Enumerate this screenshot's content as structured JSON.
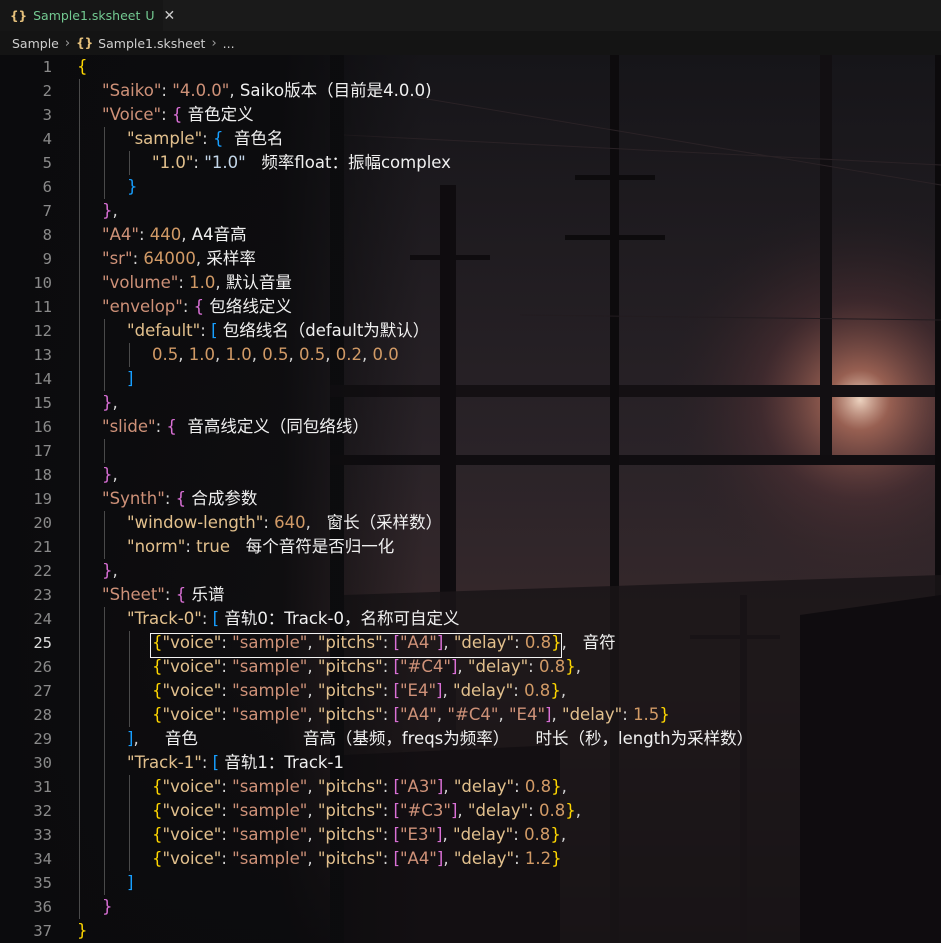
{
  "tab": {
    "icon": "{}",
    "name": "Sample1.sksheet",
    "status": "U",
    "close": "✕"
  },
  "breadcrumb": {
    "folder": "Sample",
    "icon": "{}",
    "file": "Sample1.sksheet",
    "more": "..."
  },
  "colors": {
    "string": "#ce9178",
    "key": "#e2c08d",
    "number": "#d19a66",
    "bracket1": "#ffd700",
    "bracket2": "#da70d6",
    "bracket3": "#179fff"
  },
  "lines": [
    {
      "n": "1",
      "indent": 0,
      "tokens": [
        [
          "b1",
          "{"
        ]
      ]
    },
    {
      "n": "2",
      "indent": 1,
      "tokens": [
        [
          "k1",
          "\"Saiko\""
        ],
        [
          "p",
          ": "
        ],
        [
          "str",
          "\"4.0.0\""
        ],
        [
          "p",
          ", "
        ],
        [
          "cm",
          "Saiko版本（目前是4.0.0)"
        ]
      ]
    },
    {
      "n": "3",
      "indent": 1,
      "tokens": [
        [
          "k1",
          "\"Voice\""
        ],
        [
          "p",
          ": "
        ],
        [
          "b2",
          "{ "
        ],
        [
          "cm",
          "音色定义"
        ]
      ]
    },
    {
      "n": "4",
      "indent": 2,
      "tokens": [
        [
          "k2",
          "\"sample\""
        ],
        [
          "p",
          ": "
        ],
        [
          "b3",
          "{  "
        ],
        [
          "cm",
          "音色名"
        ]
      ]
    },
    {
      "n": "5",
      "indent": 3,
      "tokens": [
        [
          "kw",
          "\"1.0\""
        ],
        [
          "p",
          ": "
        ],
        [
          "strv",
          "\"1.0\""
        ],
        [
          "p",
          "   "
        ],
        [
          "cm",
          "频率float：振幅complex"
        ]
      ]
    },
    {
      "n": "6",
      "indent": 2,
      "tokens": [
        [
          "b3",
          "}"
        ]
      ]
    },
    {
      "n": "7",
      "indent": 1,
      "tokens": [
        [
          "b2",
          "}"
        ],
        [
          "p",
          ","
        ]
      ]
    },
    {
      "n": "8",
      "indent": 1,
      "tokens": [
        [
          "k1",
          "\"A4\""
        ],
        [
          "p",
          ": "
        ],
        [
          "num",
          "440"
        ],
        [
          "p",
          ", "
        ],
        [
          "cm",
          "A4音高"
        ]
      ]
    },
    {
      "n": "9",
      "indent": 1,
      "tokens": [
        [
          "k1",
          "\"sr\""
        ],
        [
          "p",
          ": "
        ],
        [
          "num",
          "64000"
        ],
        [
          "p",
          ", "
        ],
        [
          "cm",
          "采样率"
        ]
      ]
    },
    {
      "n": "10",
      "indent": 1,
      "tokens": [
        [
          "k1",
          "\"volume\""
        ],
        [
          "p",
          ": "
        ],
        [
          "num",
          "1.0"
        ],
        [
          "p",
          ", "
        ],
        [
          "cm",
          "默认音量"
        ]
      ]
    },
    {
      "n": "11",
      "indent": 1,
      "tokens": [
        [
          "k1",
          "\"envelop\""
        ],
        [
          "p",
          ": "
        ],
        [
          "b2",
          "{ "
        ],
        [
          "cm",
          "包络线定义"
        ]
      ]
    },
    {
      "n": "12",
      "indent": 2,
      "tokens": [
        [
          "k2",
          "\"default\""
        ],
        [
          "p",
          ": "
        ],
        [
          "b3",
          "[ "
        ],
        [
          "cm",
          "包络线名（default为默认）"
        ]
      ]
    },
    {
      "n": "13",
      "indent": 3,
      "tokens": [
        [
          "num",
          "0.5"
        ],
        [
          "p",
          ", "
        ],
        [
          "num",
          "1.0"
        ],
        [
          "p",
          ", "
        ],
        [
          "num",
          "1.0"
        ],
        [
          "p",
          ", "
        ],
        [
          "num",
          "0.5"
        ],
        [
          "p",
          ", "
        ],
        [
          "num",
          "0.5"
        ],
        [
          "p",
          ", "
        ],
        [
          "num",
          "0.2"
        ],
        [
          "p",
          ", "
        ],
        [
          "num",
          "0.0"
        ]
      ]
    },
    {
      "n": "14",
      "indent": 2,
      "tokens": [
        [
          "b3",
          "]"
        ]
      ]
    },
    {
      "n": "15",
      "indent": 1,
      "tokens": [
        [
          "b2",
          "}"
        ],
        [
          "p",
          ","
        ]
      ]
    },
    {
      "n": "16",
      "indent": 1,
      "tokens": [
        [
          "k1",
          "\"slide\""
        ],
        [
          "p",
          ": "
        ],
        [
          "b2",
          "{  "
        ],
        [
          "cm",
          "音高线定义（同包络线）"
        ]
      ]
    },
    {
      "n": "17",
      "indent": 2,
      "tokens": []
    },
    {
      "n": "18",
      "indent": 1,
      "tokens": [
        [
          "b2",
          "}"
        ],
        [
          "p",
          ","
        ]
      ]
    },
    {
      "n": "19",
      "indent": 1,
      "tokens": [
        [
          "k1",
          "\"Synth\""
        ],
        [
          "p",
          ": "
        ],
        [
          "b2",
          "{ "
        ],
        [
          "cm",
          "合成参数"
        ]
      ]
    },
    {
      "n": "20",
      "indent": 2,
      "tokens": [
        [
          "k2",
          "\"window-length\""
        ],
        [
          "p",
          ": "
        ],
        [
          "num",
          "640"
        ],
        [
          "p",
          ",   "
        ],
        [
          "cm",
          "窗长（采样数）"
        ]
      ]
    },
    {
      "n": "21",
      "indent": 2,
      "tokens": [
        [
          "k2",
          "\"norm\""
        ],
        [
          "p",
          ": "
        ],
        [
          "kw",
          "true"
        ],
        [
          "p",
          "   "
        ],
        [
          "cm",
          "每个音符是否归一化"
        ]
      ]
    },
    {
      "n": "22",
      "indent": 1,
      "tokens": [
        [
          "b2",
          "}"
        ],
        [
          "p",
          ","
        ]
      ]
    },
    {
      "n": "23",
      "indent": 1,
      "tokens": [
        [
          "k1",
          "\"Sheet\""
        ],
        [
          "p",
          ": "
        ],
        [
          "b2",
          "{ "
        ],
        [
          "cm",
          "乐谱"
        ]
      ]
    },
    {
      "n": "24",
      "indent": 2,
      "tokens": [
        [
          "k2",
          "\"Track-0\""
        ],
        [
          "p",
          ": "
        ],
        [
          "b3",
          "[ "
        ],
        [
          "cm",
          "音轨0：Track-0，名称可自定义"
        ]
      ]
    },
    {
      "n": "25",
      "indent": 3,
      "tokens": [
        [
          "b1",
          "{"
        ],
        [
          "k2",
          "\"voice\""
        ],
        [
          "p",
          ": "
        ],
        [
          "str",
          "\"sample\""
        ],
        [
          "p",
          ", "
        ],
        [
          "k2",
          "\"pitchs\""
        ],
        [
          "p",
          ": "
        ],
        [
          "b2",
          "["
        ],
        [
          "str",
          "\"A4\""
        ],
        [
          "b2",
          "]"
        ],
        [
          "p",
          ", "
        ],
        [
          "k2",
          "\"delay\""
        ],
        [
          "p",
          ": "
        ],
        [
          "num",
          "0.8"
        ],
        [
          "b1",
          "}"
        ],
        [
          "p",
          ",   "
        ],
        [
          "cm",
          "音符"
        ]
      ]
    },
    {
      "n": "26",
      "indent": 3,
      "tokens": [
        [
          "b1",
          "{"
        ],
        [
          "k2",
          "\"voice\""
        ],
        [
          "p",
          ": "
        ],
        [
          "str",
          "\"sample\""
        ],
        [
          "p",
          ", "
        ],
        [
          "k2",
          "\"pitchs\""
        ],
        [
          "p",
          ": "
        ],
        [
          "b2",
          "["
        ],
        [
          "str",
          "\"#C4\""
        ],
        [
          "b2",
          "]"
        ],
        [
          "p",
          ", "
        ],
        [
          "k2",
          "\"delay\""
        ],
        [
          "p",
          ": "
        ],
        [
          "num",
          "0.8"
        ],
        [
          "b1",
          "}"
        ],
        [
          "p",
          ","
        ]
      ]
    },
    {
      "n": "27",
      "indent": 3,
      "tokens": [
        [
          "b1",
          "{"
        ],
        [
          "k2",
          "\"voice\""
        ],
        [
          "p",
          ": "
        ],
        [
          "str",
          "\"sample\""
        ],
        [
          "p",
          ", "
        ],
        [
          "k2",
          "\"pitchs\""
        ],
        [
          "p",
          ": "
        ],
        [
          "b2",
          "["
        ],
        [
          "str",
          "\"E4\""
        ],
        [
          "b2",
          "]"
        ],
        [
          "p",
          ", "
        ],
        [
          "k2",
          "\"delay\""
        ],
        [
          "p",
          ": "
        ],
        [
          "num",
          "0.8"
        ],
        [
          "b1",
          "}"
        ],
        [
          "p",
          ","
        ]
      ]
    },
    {
      "n": "28",
      "indent": 3,
      "tokens": [
        [
          "b1",
          "{"
        ],
        [
          "k2",
          "\"voice\""
        ],
        [
          "p",
          ": "
        ],
        [
          "str",
          "\"sample\""
        ],
        [
          "p",
          ", "
        ],
        [
          "k2",
          "\"pitchs\""
        ],
        [
          "p",
          ": "
        ],
        [
          "b2",
          "["
        ],
        [
          "str",
          "\"A4\""
        ],
        [
          "p",
          ", "
        ],
        [
          "str",
          "\"#C4\""
        ],
        [
          "p",
          ", "
        ],
        [
          "str",
          "\"E4\""
        ],
        [
          "b2",
          "]"
        ],
        [
          "p",
          ", "
        ],
        [
          "k2",
          "\"delay\""
        ],
        [
          "p",
          ": "
        ],
        [
          "num",
          "1.5"
        ],
        [
          "b1",
          "}"
        ]
      ]
    },
    {
      "n": "29",
      "indent": 2,
      "tokens": [
        [
          "b3",
          "]"
        ],
        [
          "p",
          ",     "
        ],
        [
          "cm",
          "音色                    音高（基频，freqs为频率）     时长（秒，length为采样数）"
        ]
      ]
    },
    {
      "n": "30",
      "indent": 2,
      "tokens": [
        [
          "k2",
          "\"Track-1\""
        ],
        [
          "p",
          ": "
        ],
        [
          "b3",
          "[ "
        ],
        [
          "cm",
          "音轨1：Track-1"
        ]
      ]
    },
    {
      "n": "31",
      "indent": 3,
      "tokens": [
        [
          "b1",
          "{"
        ],
        [
          "k2",
          "\"voice\""
        ],
        [
          "p",
          ": "
        ],
        [
          "str",
          "\"sample\""
        ],
        [
          "p",
          ", "
        ],
        [
          "k2",
          "\"pitchs\""
        ],
        [
          "p",
          ": "
        ],
        [
          "b2",
          "["
        ],
        [
          "str",
          "\"A3\""
        ],
        [
          "b2",
          "]"
        ],
        [
          "p",
          ", "
        ],
        [
          "k2",
          "\"delay\""
        ],
        [
          "p",
          ": "
        ],
        [
          "num",
          "0.8"
        ],
        [
          "b1",
          "}"
        ],
        [
          "p",
          ","
        ]
      ]
    },
    {
      "n": "32",
      "indent": 3,
      "tokens": [
        [
          "b1",
          "{"
        ],
        [
          "k2",
          "\"voice\""
        ],
        [
          "p",
          ": "
        ],
        [
          "str",
          "\"sample\""
        ],
        [
          "p",
          ", "
        ],
        [
          "k2",
          "\"pitchs\""
        ],
        [
          "p",
          ": "
        ],
        [
          "b2",
          "["
        ],
        [
          "str",
          "\"#C3\""
        ],
        [
          "b2",
          "]"
        ],
        [
          "p",
          ", "
        ],
        [
          "k2",
          "\"delay\""
        ],
        [
          "p",
          ": "
        ],
        [
          "num",
          "0.8"
        ],
        [
          "b1",
          "}"
        ],
        [
          "p",
          ","
        ]
      ]
    },
    {
      "n": "33",
      "indent": 3,
      "tokens": [
        [
          "b1",
          "{"
        ],
        [
          "k2",
          "\"voice\""
        ],
        [
          "p",
          ": "
        ],
        [
          "str",
          "\"sample\""
        ],
        [
          "p",
          ", "
        ],
        [
          "k2",
          "\"pitchs\""
        ],
        [
          "p",
          ": "
        ],
        [
          "b2",
          "["
        ],
        [
          "str",
          "\"E3\""
        ],
        [
          "b2",
          "]"
        ],
        [
          "p",
          ", "
        ],
        [
          "k2",
          "\"delay\""
        ],
        [
          "p",
          ": "
        ],
        [
          "num",
          "0.8"
        ],
        [
          "b1",
          "}"
        ],
        [
          "p",
          ","
        ]
      ]
    },
    {
      "n": "34",
      "indent": 3,
      "tokens": [
        [
          "b1",
          "{"
        ],
        [
          "k2",
          "\"voice\""
        ],
        [
          "p",
          ": "
        ],
        [
          "str",
          "\"sample\""
        ],
        [
          "p",
          ", "
        ],
        [
          "k2",
          "\"pitchs\""
        ],
        [
          "p",
          ": "
        ],
        [
          "b2",
          "["
        ],
        [
          "str",
          "\"A4\""
        ],
        [
          "b2",
          "]"
        ],
        [
          "p",
          ", "
        ],
        [
          "k2",
          "\"delay\""
        ],
        [
          "p",
          ": "
        ],
        [
          "num",
          "1.2"
        ],
        [
          "b1",
          "}"
        ]
      ]
    },
    {
      "n": "35",
      "indent": 2,
      "tokens": [
        [
          "b3",
          "]"
        ]
      ]
    },
    {
      "n": "36",
      "indent": 1,
      "tokens": [
        [
          "b2",
          "}"
        ]
      ]
    },
    {
      "n": "37",
      "indent": 0,
      "tokens": [
        [
          "b1",
          "}"
        ]
      ]
    }
  ]
}
